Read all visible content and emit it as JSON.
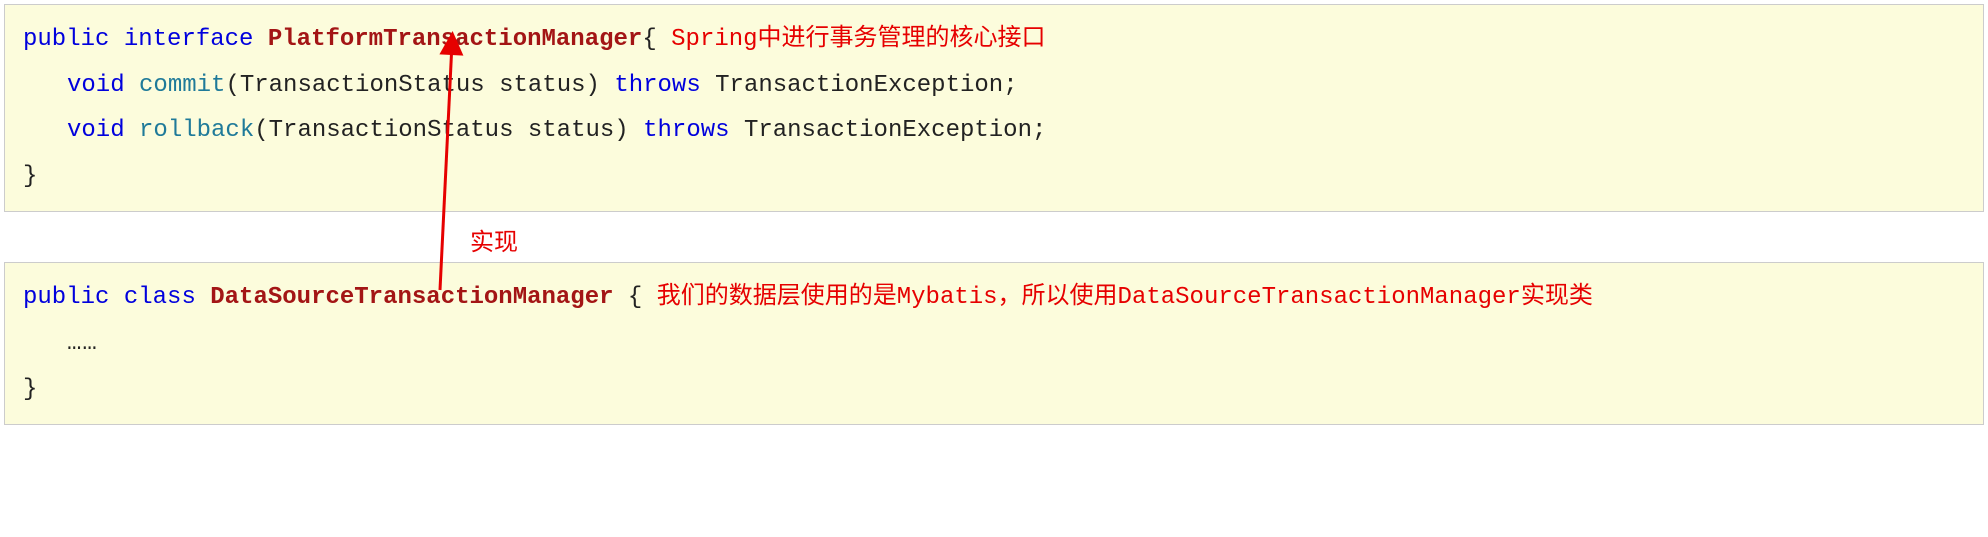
{
  "block1": {
    "public": "public",
    "interface": "interface",
    "typeName": "PlatformTransactionManager",
    "openBrace": "{",
    "annotation1": "Spring中进行事务管理的核心接口",
    "line2": {
      "void": "void",
      "method": "commit",
      "params": "(TransactionStatus status)",
      "throws": "throws",
      "exception": "TransactionException;"
    },
    "line3": {
      "void": "void",
      "method": "rollback",
      "params": "(TransactionStatus status)",
      "throws": "throws",
      "exception": "TransactionException;"
    },
    "closeBrace": "}"
  },
  "implementsLabel": "实现",
  "block2": {
    "public": "public",
    "class": "class",
    "typeName": "DataSourceTransactionManager",
    "openBrace": "{",
    "annotation2": "我们的数据层使用的是Mybatis，所以使用DataSourceTransactionManager实现类",
    "ellipsis": "……",
    "closeBrace": "}"
  }
}
